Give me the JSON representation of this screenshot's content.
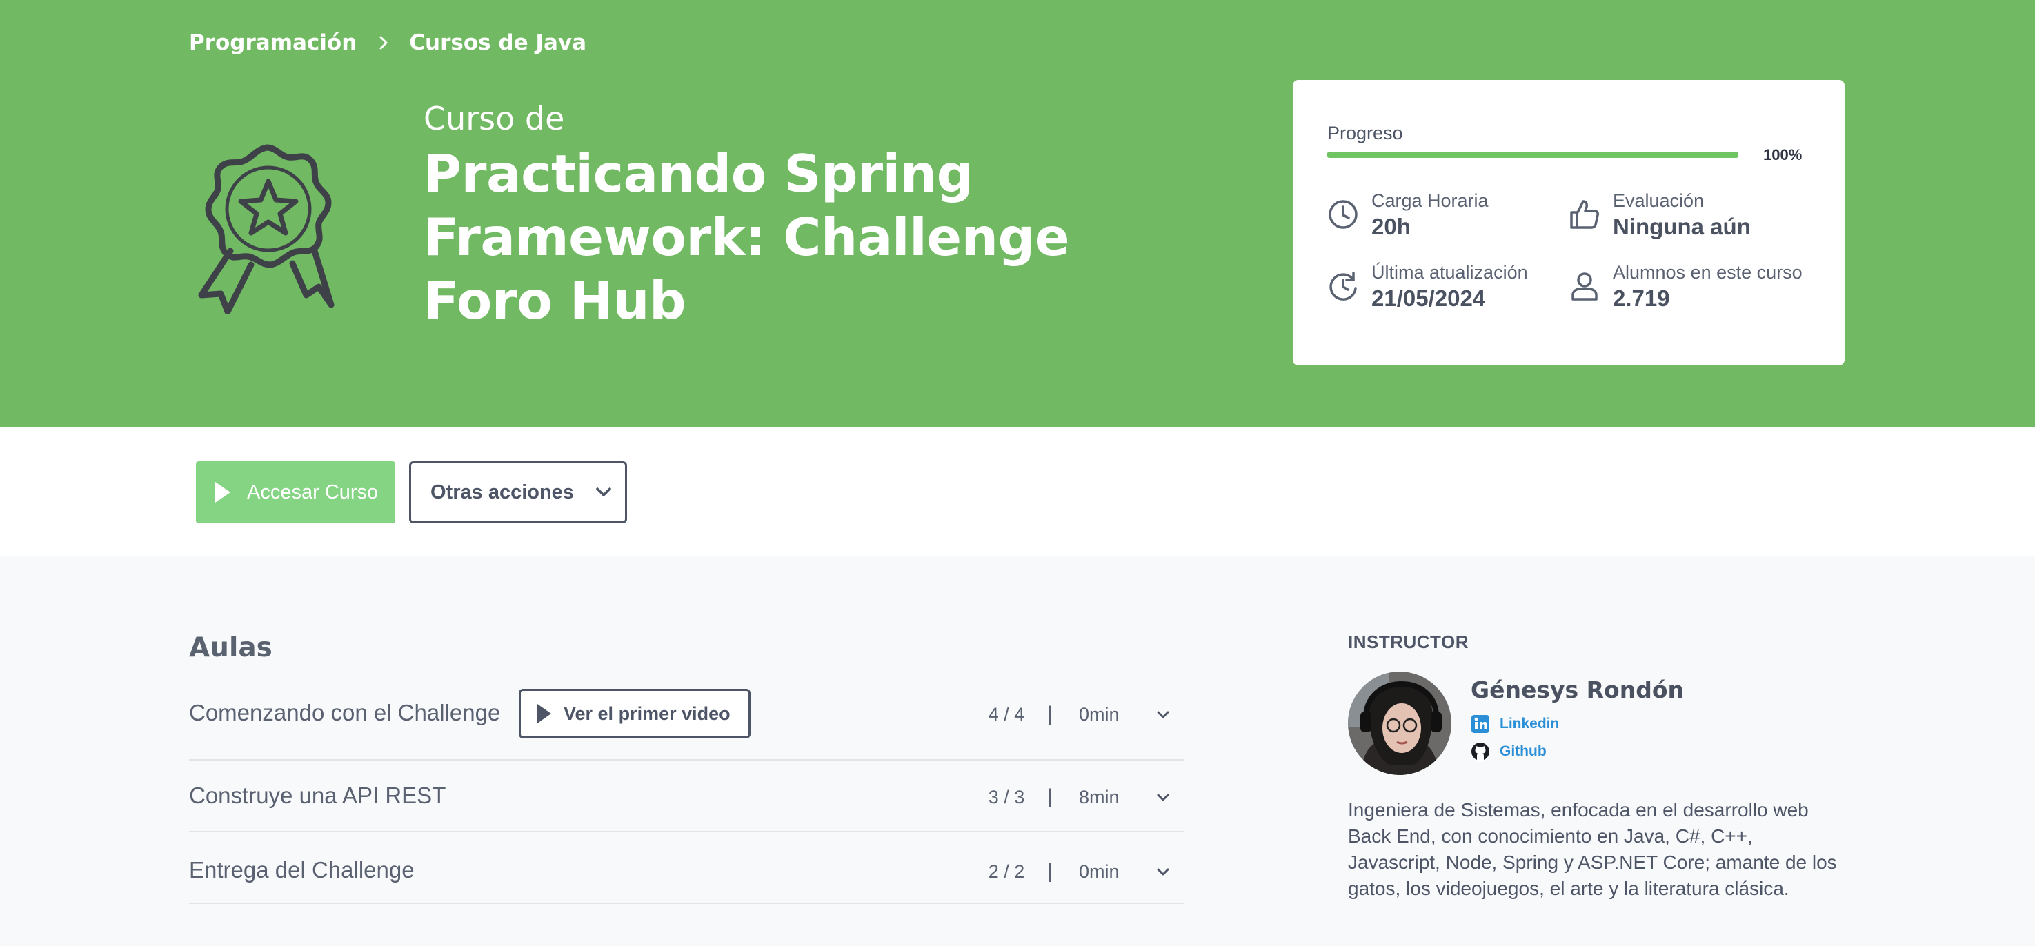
{
  "breadcrumb": {
    "items": [
      "Programación",
      "Cursos de Java"
    ]
  },
  "course": {
    "pre_title": "Curso de",
    "title": "Practicando Spring Framework: Challenge Foro Hub"
  },
  "stats": {
    "progress_label": "Progreso",
    "progress_value": 1.0,
    "progress_percent_text": "100%",
    "items": [
      {
        "icon": "clock-icon",
        "label": "Carga Horaria",
        "value": "20h"
      },
      {
        "icon": "thumbs-up-icon",
        "label": "Evaluación",
        "value": "Ninguna aún"
      },
      {
        "icon": "refresh-icon",
        "label": "Última atualización",
        "value": "21/05/2024"
      },
      {
        "icon": "user-icon",
        "label": "Alumnos en este curso",
        "value": "2.719"
      }
    ]
  },
  "actions": {
    "access_label": "Accesar Curso",
    "other_label": "Otras acciones"
  },
  "lessons": {
    "title": "Aulas",
    "first_video_label": "Ver el primer video",
    "separator": "|",
    "items": [
      {
        "name": "Comenzando con el Challenge",
        "count": "4 / 4",
        "duration": "0min"
      },
      {
        "name": "Construye una API REST",
        "count": "3 / 3",
        "duration": "8min"
      },
      {
        "name": "Entrega del Challenge",
        "count": "2 / 2",
        "duration": "0min"
      }
    ]
  },
  "instructor": {
    "label": "INSTRUCTOR",
    "name": "Génesys Rondón",
    "links": [
      {
        "icon": "linkedin-icon",
        "label": "Linkedin"
      },
      {
        "icon": "github-icon",
        "label": "Github"
      }
    ],
    "bio": "Ingeniera de Sistemas, enfocada en el desarrollo web Back End, con conocimiento en Java, C#, C++, Javascript, Node, Spring y ASP.NET Core; amante de los gatos, los videojuegos, el arte y la literatura clásica."
  },
  "colors": {
    "hero_bg": "#71b962",
    "access_button": "#84d483",
    "progress_fill": "#71c462",
    "link": "#2b8fd8"
  }
}
